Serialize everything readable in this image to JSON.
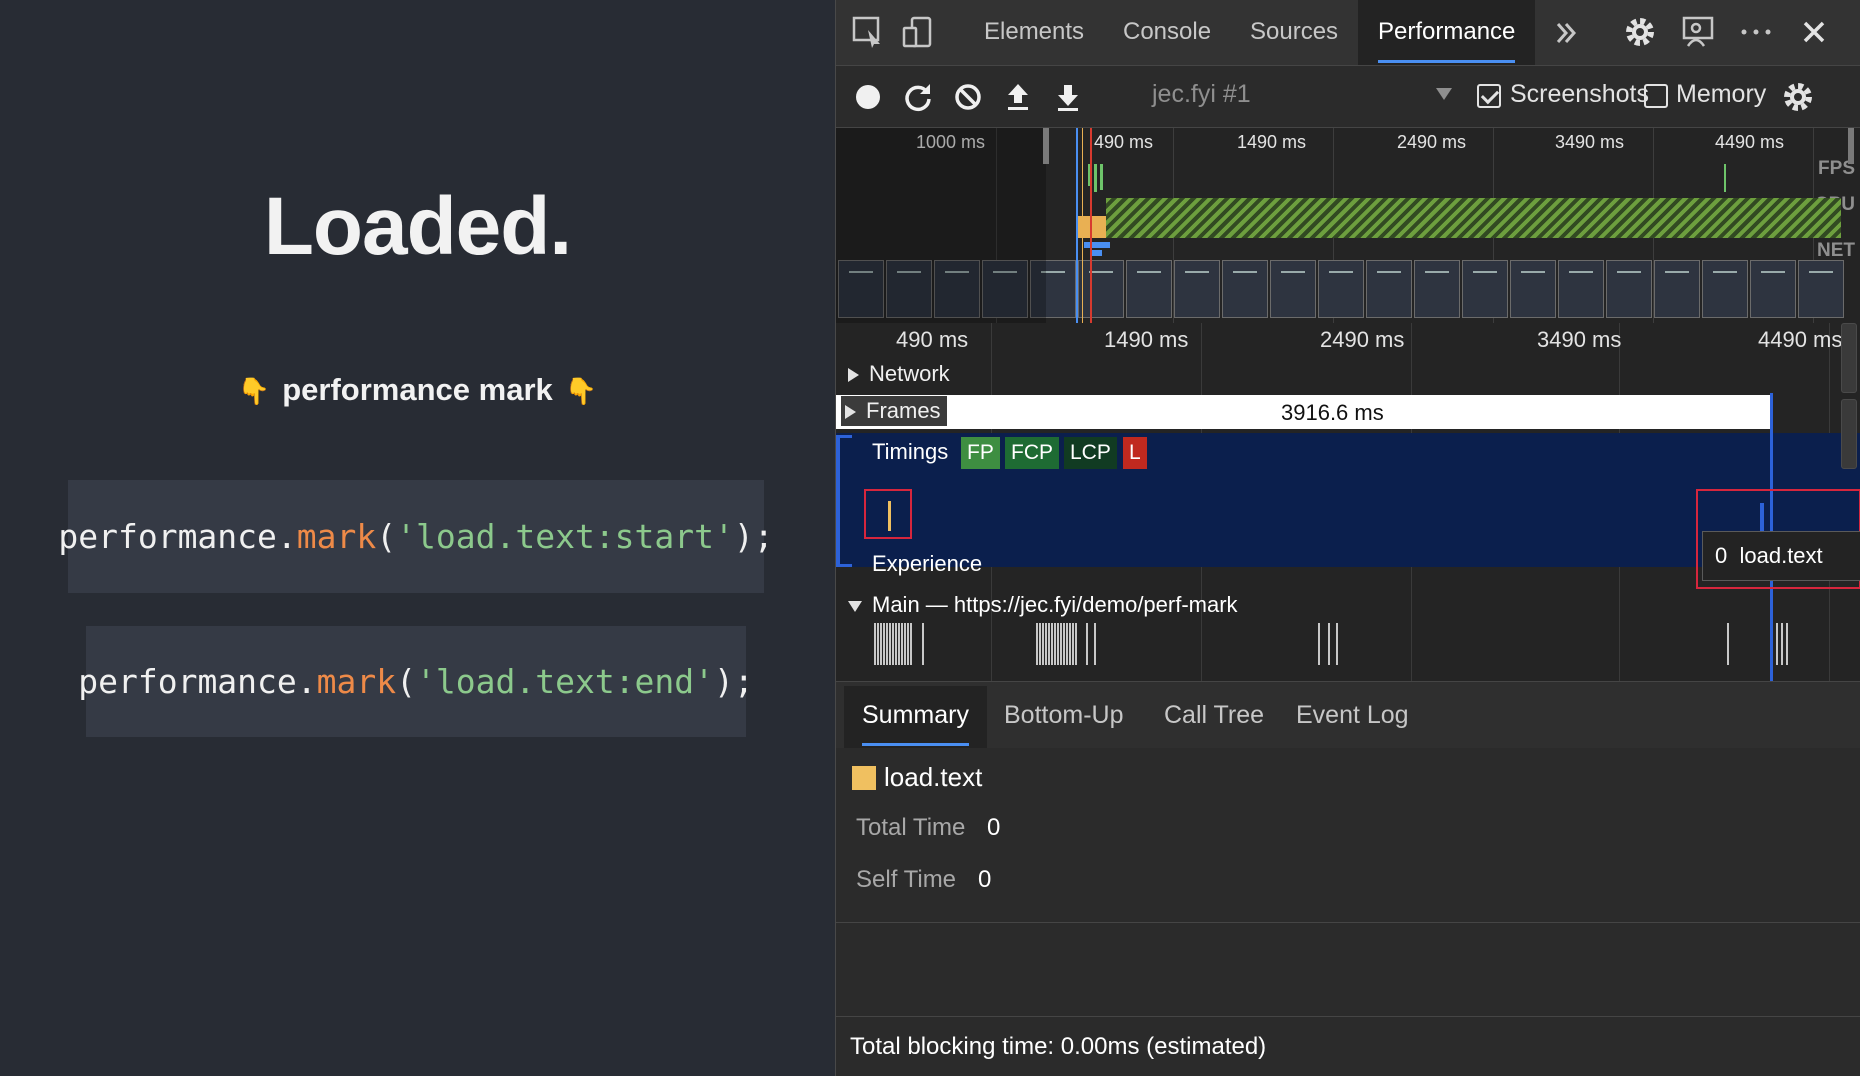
{
  "page": {
    "heading": "Loaded.",
    "subheading": "performance mark",
    "code_lines": [
      {
        "obj": "performance",
        "dot": ".",
        "fn": "mark",
        "open": "(",
        "arg": "'load.text:start'",
        "close": ");"
      },
      {
        "obj": "performance",
        "dot": ".",
        "fn": "mark",
        "open": "(",
        "arg": "'load.text:end'",
        "close": ");"
      }
    ],
    "colors": {
      "background": "#282c34",
      "code_bg": "#353a45",
      "fn": "#ee8a48",
      "string": "#8cc98c"
    }
  },
  "devtools": {
    "tabs": [
      "Elements",
      "Console",
      "Sources",
      "Performance"
    ],
    "active_tab": "Performance",
    "tab_icons": [
      "inspect-element-icon",
      "device-toolbar-icon",
      "more-tabs-icon",
      "settings-gear-icon",
      "feedback-icon",
      "more-options-icon",
      "close-icon"
    ],
    "toolbar": {
      "icons": [
        "record-icon",
        "reload-icon",
        "clear-icon",
        "upload-icon",
        "download-icon",
        "capture-settings-gear-icon"
      ],
      "profile": "jec.fyi #1",
      "screenshots_label": "Screenshots",
      "screenshots_checked": true,
      "memory_label": "Memory",
      "memory_checked": false
    },
    "overview": {
      "ticks": [
        "1000 ms",
        "490 ms",
        "1490 ms",
        "2490 ms",
        "3490 ms",
        "4490 ms"
      ],
      "lanes": [
        "FPS",
        "CPU",
        "NET"
      ]
    },
    "flame": {
      "ticks": [
        "490 ms",
        "1490 ms",
        "2490 ms",
        "3490 ms",
        "4490 ms"
      ],
      "tracks": {
        "network": "Network",
        "frames": "Frames",
        "frames_duration": "3916.6 ms",
        "timings": "Timings",
        "experience": "Experience",
        "main": "Main — https://jec.fyi/demo/perf-mark"
      },
      "timing_markers": [
        {
          "label": "FP",
          "color": "#3e8e41"
        },
        {
          "label": "FCP",
          "color": "#1e6b33"
        },
        {
          "label": "LCP",
          "color": "#113b22"
        },
        {
          "label": "L",
          "color": "#c0291f"
        }
      ],
      "tooltip": {
        "duration": "0",
        "name": "load.text"
      }
    },
    "bottom": {
      "tabs": [
        "Summary",
        "Bottom-Up",
        "Call Tree",
        "Event Log"
      ],
      "active_tab": "Summary",
      "summary": {
        "title": "load.text",
        "swatch_color": "#f0c060",
        "total_time_label": "Total Time",
        "total_time": "0",
        "self_time_label": "Self Time",
        "self_time": "0"
      },
      "footer": "Total blocking time: 0.00ms (estimated)"
    }
  }
}
